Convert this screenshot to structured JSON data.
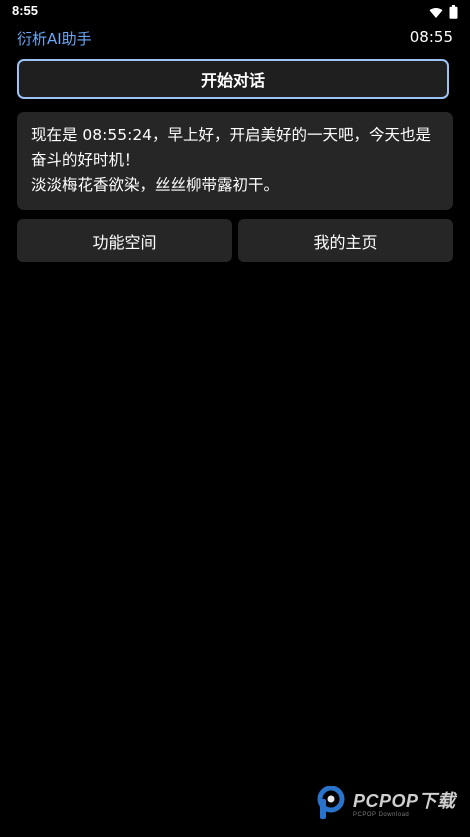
{
  "status_bar": {
    "time": "8:55",
    "icons": [
      "wifi-icon",
      "battery-icon"
    ]
  },
  "header": {
    "app_title": "衍析AI助手",
    "clock": "08:55",
    "accent_color": "#6aa8f7"
  },
  "main": {
    "start_chat_label": "开始对话",
    "greeting": {
      "line1": "现在是 08:55:24，早上好，开启美好的一天吧，今天也是奋斗的好时机！",
      "line2": "淡淡梅花香欲染，丝丝柳带露初干。"
    },
    "nav": {
      "feature_space_label": "功能空间",
      "my_home_label": "我的主页"
    }
  },
  "watermark": {
    "brand": "PCPOP下载",
    "sub": "PCPOP Download"
  }
}
